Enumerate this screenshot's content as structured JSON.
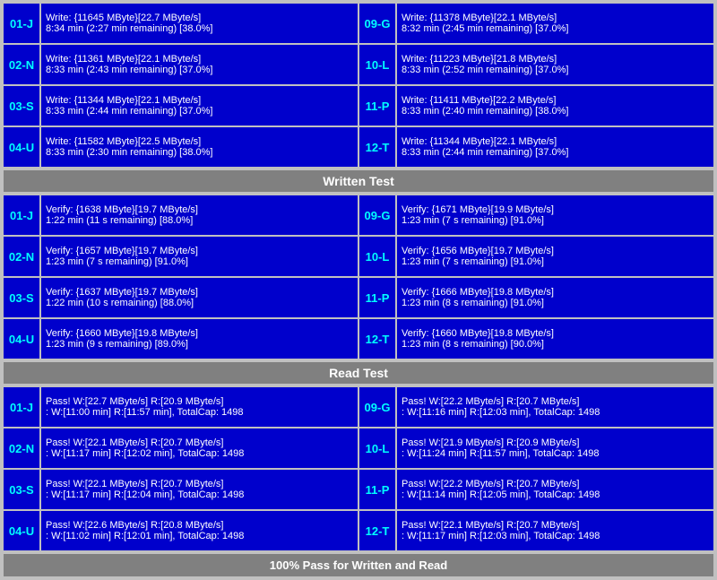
{
  "sections": {
    "write_test": {
      "label": "Written Test",
      "rows": [
        {
          "left": {
            "id": "01-J",
            "line1": "Write: {11645 MByte}[22.7 MByte/s]",
            "line2": "8:34 min (2:27 min remaining)  [38.0%]"
          },
          "right": {
            "id": "09-G",
            "line1": "Write: {11378 MByte}[22.1 MByte/s]",
            "line2": "8:32 min (2:45 min remaining)  [37.0%]"
          }
        },
        {
          "left": {
            "id": "02-N",
            "line1": "Write: {11361 MByte}[22.1 MByte/s]",
            "line2": "8:33 min (2:43 min remaining)  [37.0%]"
          },
          "right": {
            "id": "10-L",
            "line1": "Write: {11223 MByte}[21.8 MByte/s]",
            "line2": "8:33 min (2:52 min remaining)  [37.0%]"
          }
        },
        {
          "left": {
            "id": "03-S",
            "line1": "Write: {11344 MByte}[22.1 MByte/s]",
            "line2": "8:33 min (2:44 min remaining)  [37.0%]"
          },
          "right": {
            "id": "11-P",
            "line1": "Write: {11411 MByte}[22.2 MByte/s]",
            "line2": "8:33 min (2:40 min remaining)  [38.0%]"
          }
        },
        {
          "left": {
            "id": "04-U",
            "line1": "Write: {11582 MByte}[22.5 MByte/s]",
            "line2": "8:33 min (2:30 min remaining)  [38.0%]"
          },
          "right": {
            "id": "12-T",
            "line1": "Write: {11344 MByte}[22.1 MByte/s]",
            "line2": "8:33 min (2:44 min remaining)  [37.0%]"
          }
        }
      ]
    },
    "verify_test": {
      "label": "Written Test",
      "rows": [
        {
          "left": {
            "id": "01-J",
            "line1": "Verify: {1638 MByte}[19.7 MByte/s]",
            "line2": "1:22 min (11 s remaining)   [88.0%]"
          },
          "right": {
            "id": "09-G",
            "line1": "Verify: {1671 MByte}[19.9 MByte/s]",
            "line2": "1:23 min (7 s remaining)   [91.0%]"
          }
        },
        {
          "left": {
            "id": "02-N",
            "line1": "Verify: {1657 MByte}[19.7 MByte/s]",
            "line2": "1:23 min (7 s remaining)   [91.0%]"
          },
          "right": {
            "id": "10-L",
            "line1": "Verify: {1656 MByte}[19.7 MByte/s]",
            "line2": "1:23 min (7 s remaining)   [91.0%]"
          }
        },
        {
          "left": {
            "id": "03-S",
            "line1": "Verify: {1637 MByte}[19.7 MByte/s]",
            "line2": "1:22 min (10 s remaining)   [88.0%]"
          },
          "right": {
            "id": "11-P",
            "line1": "Verify: {1666 MByte}[19.8 MByte/s]",
            "line2": "1:23 min (8 s remaining)   [91.0%]"
          }
        },
        {
          "left": {
            "id": "04-U",
            "line1": "Verify: {1660 MByte}[19.8 MByte/s]",
            "line2": "1:23 min (9 s remaining)   [89.0%]"
          },
          "right": {
            "id": "12-T",
            "line1": "Verify: {1660 MByte}[19.8 MByte/s]",
            "line2": "1:23 min (8 s remaining)   [90.0%]"
          }
        }
      ]
    },
    "read_test": {
      "label": "Read Test",
      "rows": [
        {
          "left": {
            "id": "01-J",
            "line1": "Pass! W:[22.7 MByte/s] R:[20.9 MByte/s]",
            "line2": ": W:[11:00 min] R:[11:57 min], TotalCap: 1498"
          },
          "right": {
            "id": "09-G",
            "line1": "Pass! W:[22.2 MByte/s] R:[20.7 MByte/s]",
            "line2": ": W:[11:16 min] R:[12:03 min], TotalCap: 1498"
          }
        },
        {
          "left": {
            "id": "02-N",
            "line1": "Pass! W:[22.1 MByte/s] R:[20.7 MByte/s]",
            "line2": ": W:[11:17 min] R:[12:02 min], TotalCap: 1498"
          },
          "right": {
            "id": "10-L",
            "line1": "Pass! W:[21.9 MByte/s] R:[20.9 MByte/s]",
            "line2": ": W:[11:24 min] R:[11:57 min], TotalCap: 1498"
          }
        },
        {
          "left": {
            "id": "03-S",
            "line1": "Pass! W:[22.1 MByte/s] R:[20.7 MByte/s]",
            "line2": ": W:[11:17 min] R:[12:04 min], TotalCap: 1498"
          },
          "right": {
            "id": "11-P",
            "line1": "Pass! W:[22.2 MByte/s] R:[20.7 MByte/s]",
            "line2": ": W:[11:14 min] R:[12:05 min], TotalCap: 1498"
          }
        },
        {
          "left": {
            "id": "04-U",
            "line1": "Pass! W:[22.6 MByte/s] R:[20.8 MByte/s]",
            "line2": ": W:[11:02 min] R:[12:01 min], TotalCap: 1498"
          },
          "right": {
            "id": "12-T",
            "line1": "Pass! W:[22.1 MByte/s] R:[20.7 MByte/s]",
            "line2": ": W:[11:17 min] R:[12:03 min], TotalCap: 1498"
          }
        }
      ]
    }
  },
  "headers": {
    "written_test": "Written Test",
    "read_test": "Read Test"
  },
  "status": "100% Pass for Written and Read"
}
